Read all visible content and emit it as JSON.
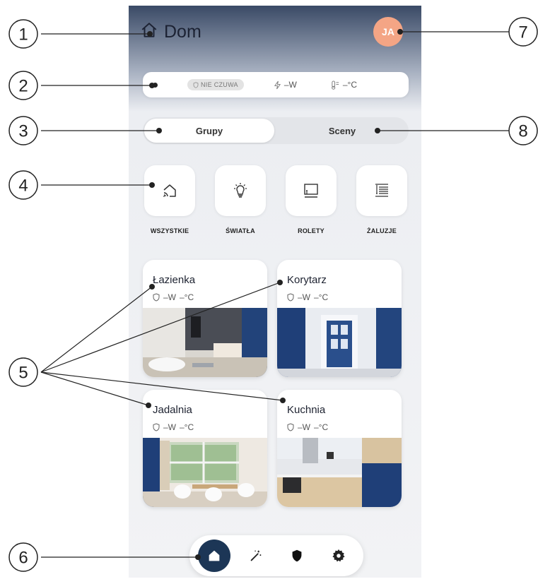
{
  "header": {
    "title": "Dom",
    "avatar_initials": "JA"
  },
  "status": {
    "alarm": "NIE CZUWA",
    "power": "–W",
    "temperature": "–°C"
  },
  "tabs": [
    {
      "label": "Grupy",
      "active": true
    },
    {
      "label": "Sceny",
      "active": false
    }
  ],
  "categories": [
    {
      "label": "WSZYSTKIE",
      "icon": "smart-home-icon"
    },
    {
      "label": "ŚWIATŁA",
      "icon": "light-bulb-icon"
    },
    {
      "label": "ROLETY",
      "icon": "roller-blind-icon"
    },
    {
      "label": "ŻALUZJE",
      "icon": "venetian-blind-icon"
    }
  ],
  "rooms": [
    {
      "name": "Łazienka",
      "power": "–W",
      "temperature": "–°C"
    },
    {
      "name": "Korytarz",
      "power": "–W",
      "temperature": "–°C"
    },
    {
      "name": "Jadalnia",
      "power": "–W",
      "temperature": "–°C"
    },
    {
      "name": "Kuchnia",
      "power": "–W",
      "temperature": "–°C"
    }
  ],
  "nav": [
    {
      "icon": "home-icon",
      "active": true
    },
    {
      "icon": "magic-wand-icon",
      "active": false
    },
    {
      "icon": "shield-icon",
      "active": false
    },
    {
      "icon": "gear-icon",
      "active": false
    }
  ],
  "callouts": [
    "1",
    "2",
    "3",
    "4",
    "5",
    "6",
    "7",
    "8"
  ],
  "colors": {
    "accent": "#1c3656",
    "avatar": "#f4a585",
    "header_top": "#3a4a66"
  }
}
